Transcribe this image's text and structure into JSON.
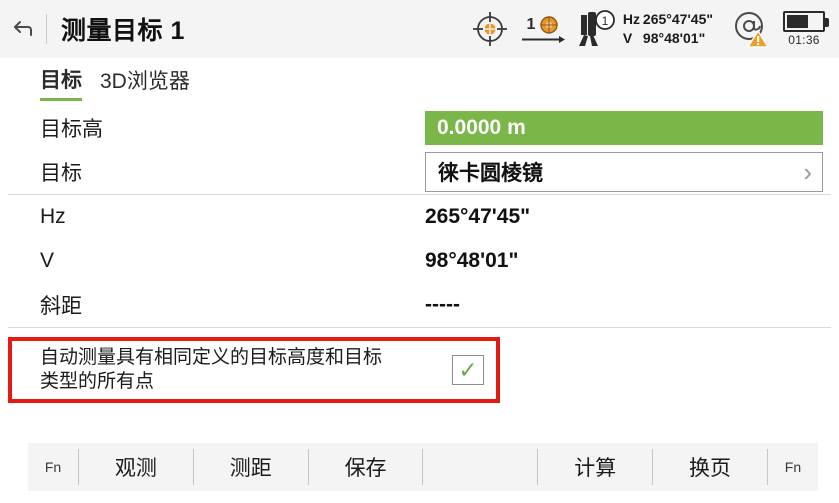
{
  "header": {
    "back_icon": "back-arrow-icon",
    "title": "测量目标 1",
    "icons": {
      "reticle": "target-reticle-icon",
      "prism_number": "1",
      "prism_icon": "prism-icon",
      "station_icon": "total-station-icon",
      "station_badge": "1",
      "at_icon": "at-sign-warning-icon"
    },
    "angles": {
      "hz_label": "Hz",
      "hz_value": "265°47'45\"",
      "v_label": "V",
      "v_value": "98°48'01\""
    },
    "battery": {
      "icon": "battery-icon",
      "level_percent": 62,
      "time_remaining": "01:36"
    }
  },
  "tabs": [
    {
      "label": "目标",
      "active": true
    },
    {
      "label": "3D浏览器",
      "active": false
    }
  ],
  "form": {
    "target_height": {
      "label": "目标高",
      "value": "0.0000 m"
    },
    "target": {
      "label": "目标",
      "value": "徕卡圆棱镜",
      "chevron": "chevron-right-icon"
    },
    "hz": {
      "label": "Hz",
      "value": "265°47'45\""
    },
    "v": {
      "label": "V",
      "value": "98°48'01\""
    },
    "slope_distance": {
      "label": "斜距",
      "value": "-----"
    }
  },
  "auto_measure": {
    "text": "自动测量具有相同定义的目标高度和目标类型的所有点",
    "checked": true,
    "check_glyph": "✓",
    "highlight_color": "#e31b13"
  },
  "toolbar": {
    "fn_left": "Fn",
    "keys": [
      "观测",
      "测距",
      "保存"
    ],
    "keys_right": [
      "计算",
      "换页"
    ],
    "fn_right": "Fn"
  },
  "colors": {
    "accent_green": "#7ab648",
    "header_bg": "#f4f4f4",
    "highlight_red": "#e31b13",
    "orange": "#e8962e"
  }
}
